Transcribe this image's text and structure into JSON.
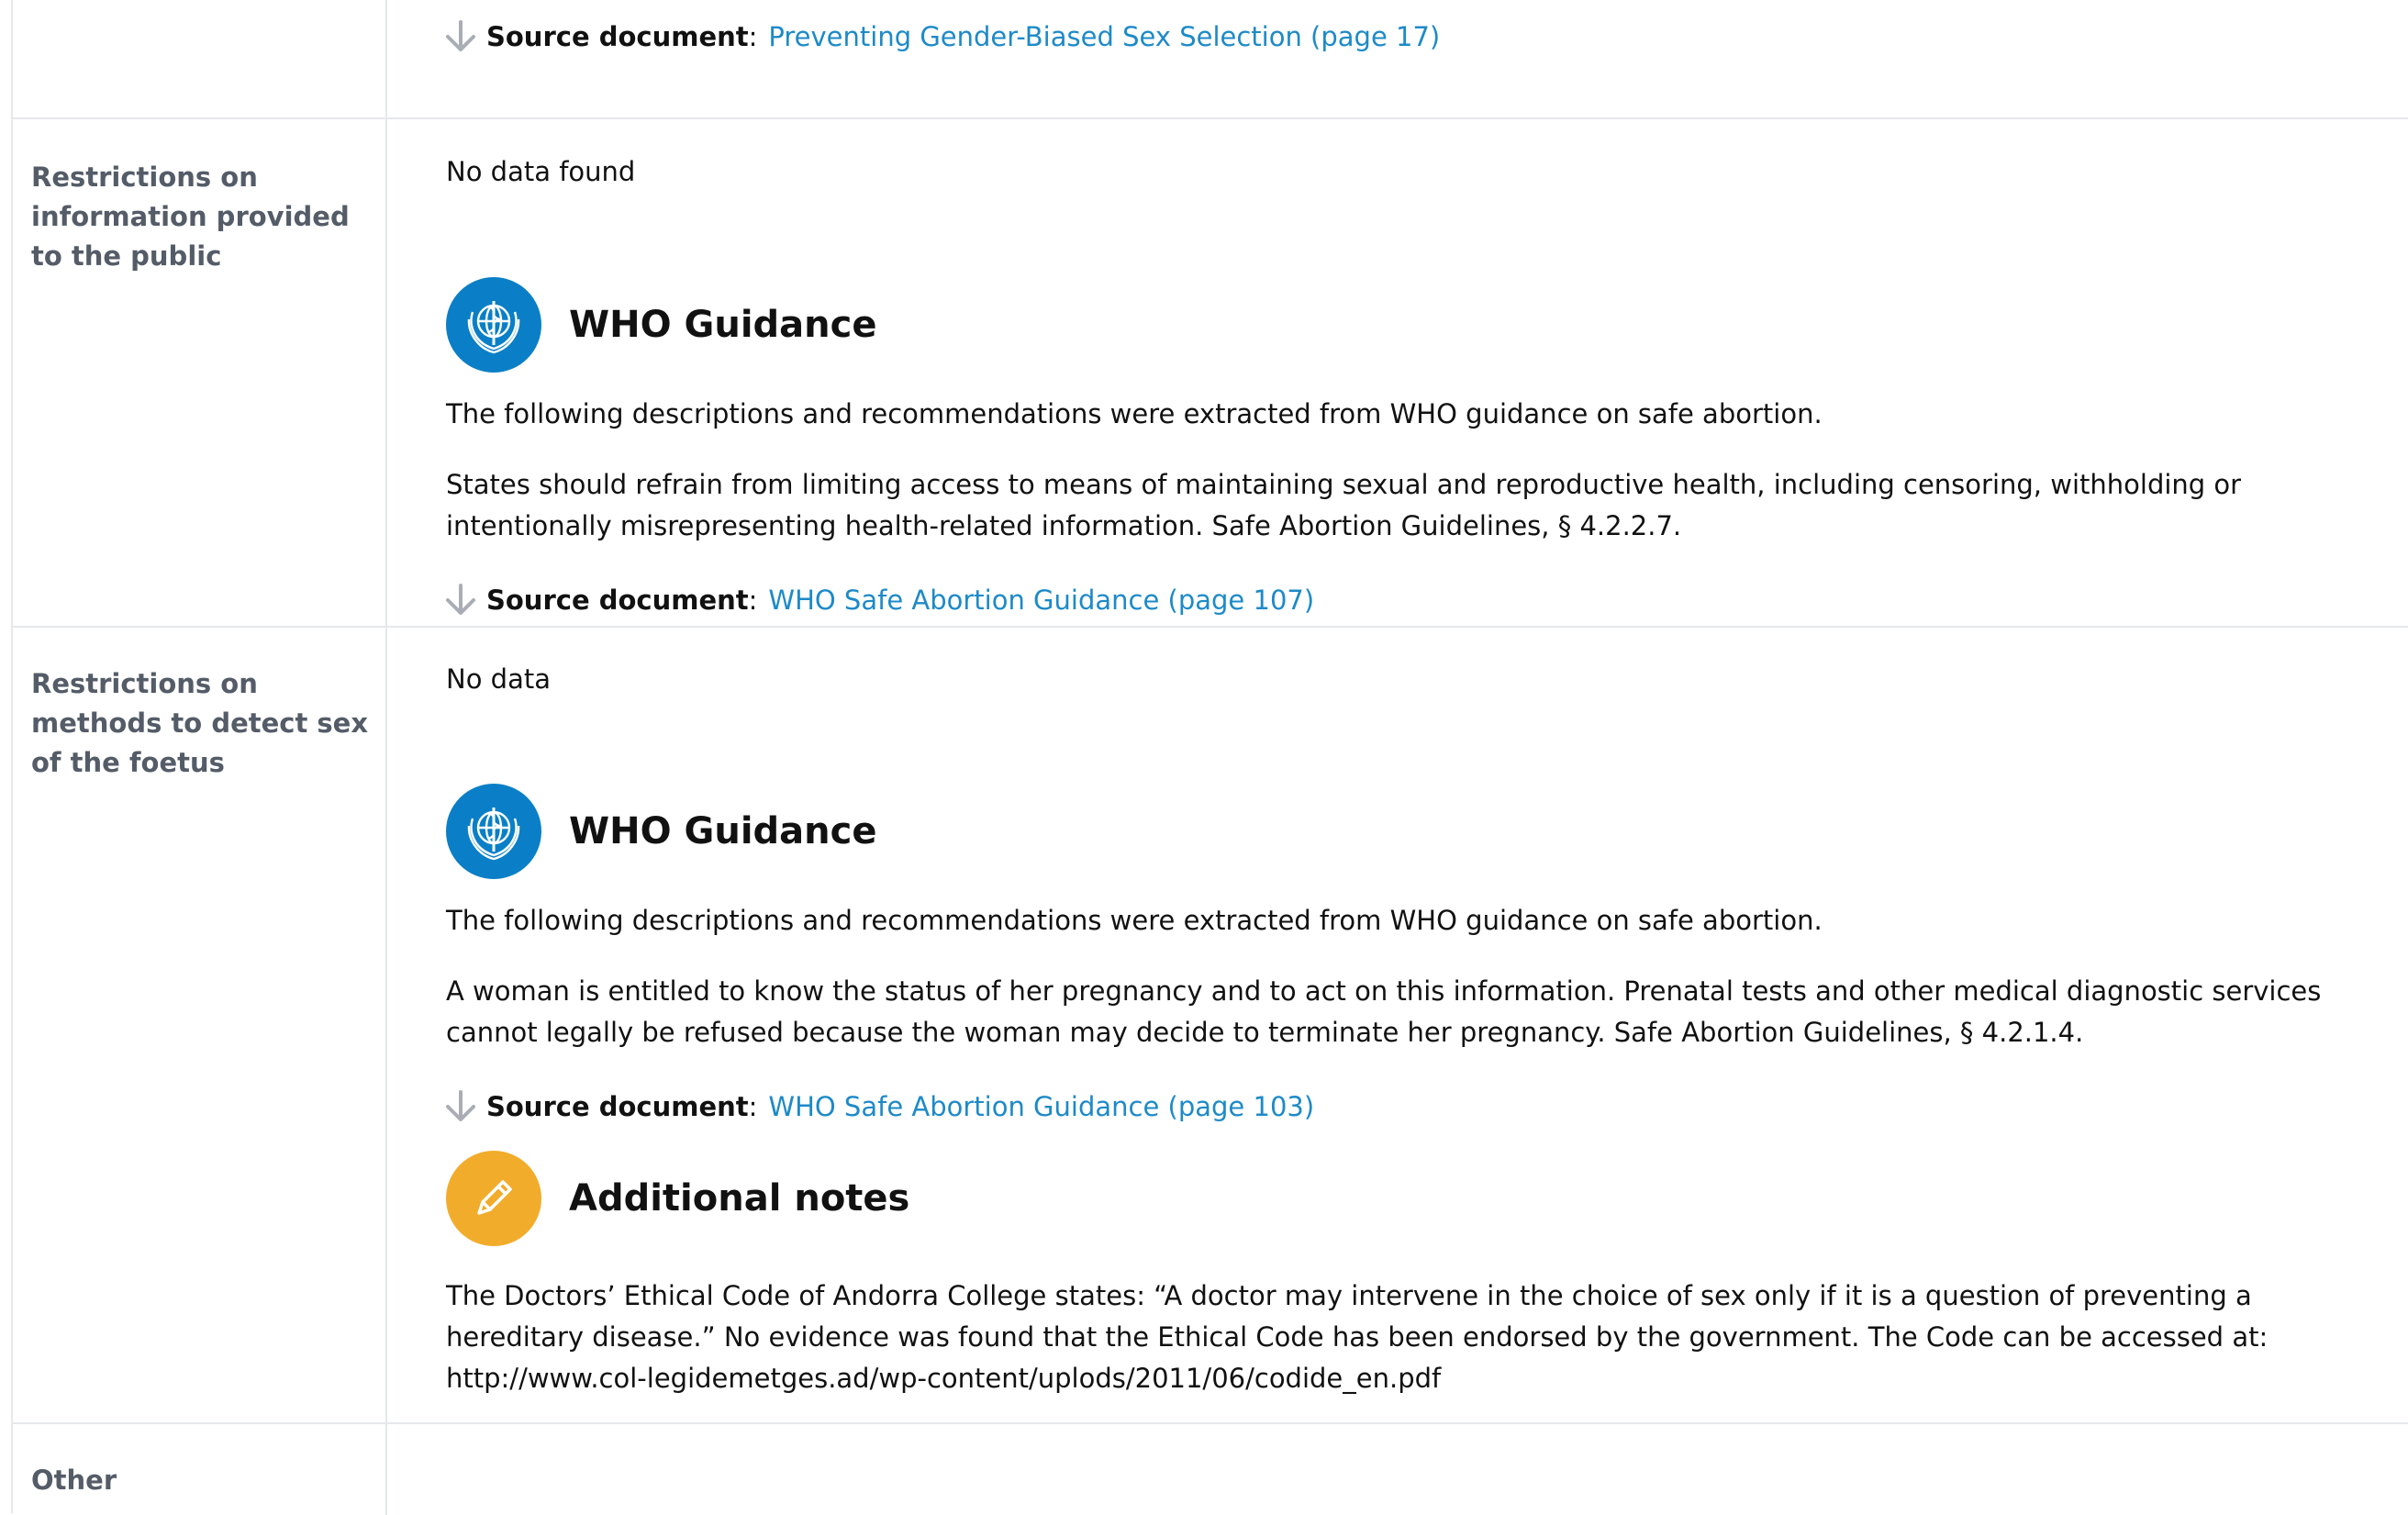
{
  "rows": [
    {
      "source": {
        "label": "Source document",
        "colon": ":",
        "link": "Preventing Gender-Biased Sex Selection (page 17)"
      }
    },
    {
      "label": "Restrictions on information provided to the public",
      "status": "No data found",
      "guidance": {
        "title": "WHO Guidance",
        "intro": "The following descriptions and recommendations were extracted from WHO guidance on safe abortion.",
        "text": "States should refrain from limiting access to means of maintaining sexual and reproductive health, including censoring, withholding or intentionally misrepresenting health-related information. Safe Abortion Guidelines, § 4.2.2.7.",
        "source_label": "Source document",
        "source_colon": ":",
        "source_link": "WHO Safe Abortion Guidance (page 107)"
      }
    },
    {
      "label": "Restrictions on methods to detect sex of the foetus",
      "status": "No data",
      "guidance": {
        "title": "WHO Guidance",
        "intro": "The following descriptions and recommendations were extracted from WHO guidance on safe abortion.",
        "text": "A woman is entitled to know the status of her pregnancy and to act on this information. Prenatal tests and other medical diagnostic services cannot legally be refused because the woman may decide to terminate her pregnancy. Safe Abortion Guidelines, § 4.2.1.4.",
        "source_label": "Source document",
        "source_colon": ":",
        "source_link": "WHO Safe Abortion Guidance (page 103)"
      },
      "notes": {
        "title": "Additional notes",
        "text": "The Doctors’ Ethical Code of Andorra College states: “A doctor may intervene in the choice of sex only if it is a question of preventing a hereditary disease.” No evidence was found that the Ethical Code has been endorsed by the government. The Code can be accessed at: http://www.col-legidemetges.ad/wp-content/uplods/2011/06/codide_en.pdf"
      }
    },
    {
      "label": "Other"
    }
  ],
  "icons": {
    "guidance": "who-emblem-icon",
    "notes": "pencil-icon",
    "source": "arrow-down-icon"
  },
  "colors": {
    "who_blue": "#0a7fc7",
    "notes_orange": "#f2ac2b",
    "link_blue": "#1d8ac8",
    "label_gray": "#545c68"
  }
}
